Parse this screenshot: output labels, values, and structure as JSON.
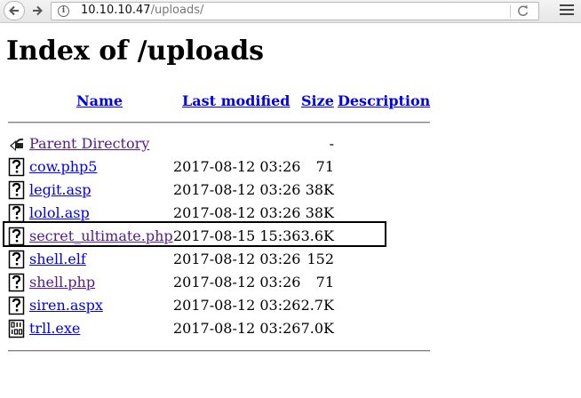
{
  "browser": {
    "url_host": "10.10.10.47",
    "url_path": "/uploads/"
  },
  "page": {
    "title": "Index of /uploads"
  },
  "table": {
    "headers": {
      "name": "Name",
      "last_modified": "Last modified",
      "size": "Size",
      "description": "Description"
    },
    "rows": [
      {
        "name": "Parent Directory",
        "date": "",
        "size": "-",
        "icon": "back-arrow-icon",
        "visited": true
      },
      {
        "name": "cow.php5",
        "date": "2017-08-12 03:26",
        "size": "71",
        "icon": "unknown-file-icon",
        "visited": false
      },
      {
        "name": "legit.asp",
        "date": "2017-08-12 03:26",
        "size": "38K",
        "icon": "unknown-file-icon",
        "visited": false
      },
      {
        "name": "lolol.asp",
        "date": "2017-08-12 03:26",
        "size": "38K",
        "icon": "unknown-file-icon",
        "visited": false
      },
      {
        "name": "secret_ultimate.php",
        "date": "2017-08-15 15:36",
        "size": "3.6K",
        "icon": "unknown-file-icon",
        "visited": true
      },
      {
        "name": "shell.elf",
        "date": "2017-08-12 03:26",
        "size": "152",
        "icon": "unknown-file-icon",
        "visited": false
      },
      {
        "name": "shell.php",
        "date": "2017-08-12 03:26",
        "size": "71",
        "icon": "unknown-file-icon",
        "visited": true
      },
      {
        "name": "siren.aspx",
        "date": "2017-08-12 03:26",
        "size": "2.7K",
        "icon": "unknown-file-icon",
        "visited": false
      },
      {
        "name": "trll.exe",
        "date": "2017-08-12 03:26",
        "size": "7.0K",
        "icon": "binary-file-icon",
        "visited": false
      }
    ]
  },
  "colors": {
    "link": "#0000ee",
    "visited_link": "#551a8b",
    "highlight_border": "#000000"
  }
}
